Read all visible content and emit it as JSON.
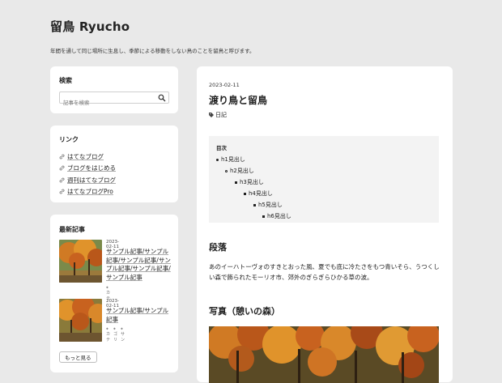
{
  "site": {
    "title": "留鳥 Ryucho",
    "description": "年間を通して同じ場所に生息し、季節による移動をしない鳥のことを留鳥と呼びます。"
  },
  "search": {
    "heading": "検索",
    "placeholder": "記事を検索",
    "button_icon": "search-icon"
  },
  "links": {
    "heading": "リンク",
    "items": [
      {
        "label": "はてなブログ",
        "icon": "link-icon"
      },
      {
        "label": "ブログをはじめる",
        "icon": "link-icon"
      },
      {
        "label": "週刊はてなブログ",
        "icon": "link-icon"
      },
      {
        "label": "はてなブログPro",
        "icon": "link-icon"
      }
    ]
  },
  "recent": {
    "heading": "最新記事",
    "items": [
      {
        "date": "2023-02-11",
        "title": "サンプル記事/サンプル記事/サンプル記事/サンプル記事/サンプル記事/サンプル記事",
        "tags": [
          "カテ"
        ]
      },
      {
        "date": "2023-02-11",
        "title": "サンプル記事/サンプル記事",
        "tags": [
          "カテ",
          "ゴリ",
          "サン"
        ]
      }
    ],
    "more_label": "もっと見る"
  },
  "post": {
    "date": "2023-02-11",
    "title": "渡り鳥と留鳥",
    "category": "日記",
    "toc": {
      "title": "目次",
      "items": [
        "h1見出し",
        "h2見出し",
        "h3見出し",
        "h4見出し",
        "h5見出し",
        "h6見出し"
      ]
    },
    "section1_heading": "段落",
    "paragraph": "あのイーハトーヴォのすきとおった風、夏でも底に冷たさをもつ青いそら、うつくしい森で飾られたモーリオ市、郊外のぎらぎらひかる草の波。",
    "section2_heading": "写真（憩いの森）"
  },
  "colors": {
    "background": "#e9e9e9",
    "card": "#ffffff",
    "toc_bg": "#f3f3f3",
    "foliage": "#c8621f"
  }
}
